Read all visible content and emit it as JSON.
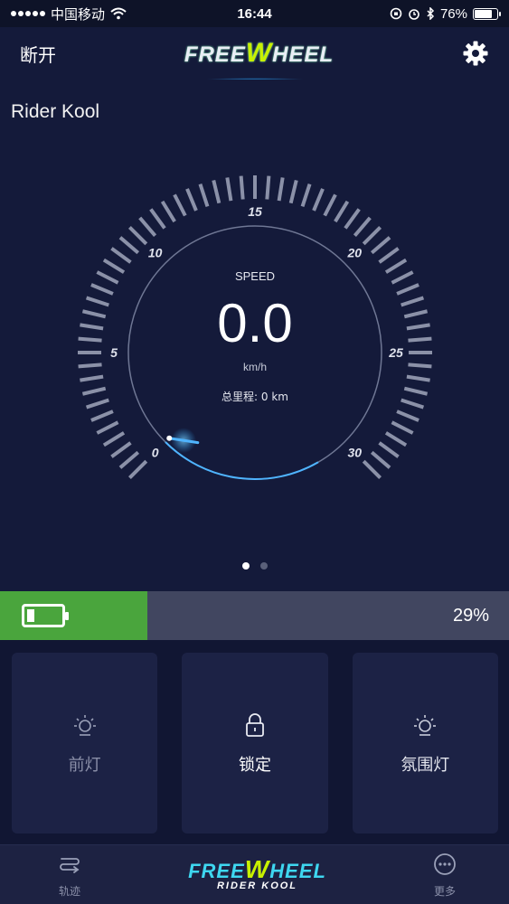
{
  "status_bar": {
    "carrier": "中国移动",
    "time": "16:44",
    "battery_pct": "76%"
  },
  "nav": {
    "left_label": "断开",
    "logo_pre": "FREE",
    "logo_w": "W",
    "logo_post": "HEEL",
    "settings_icon": "gear-icon"
  },
  "main": {
    "rider_name": "Rider Kool",
    "gauge": {
      "speed_label": "SPEED",
      "speed_value": "0.0",
      "unit": "km/h",
      "total_mileage": "总里程: 0 km",
      "tick_labels": [
        "0",
        "5",
        "10",
        "15",
        "20",
        "25",
        "30"
      ],
      "current_speed": 0
    },
    "page_dots": 2,
    "active_dot": 0
  },
  "battery": {
    "level": 0.29,
    "percent_text": "29%"
  },
  "controls": [
    {
      "label": "前灯",
      "icon": "sun-icon"
    },
    {
      "label": "锁定",
      "icon": "lock-icon"
    },
    {
      "label": "氛围灯",
      "icon": "sun-icon"
    }
  ],
  "tabbar": {
    "left_label": "轨迹",
    "logo_pre": "FREE",
    "logo_w": "W",
    "logo_post": "HEEL",
    "logo_sub": "RIDER KOOL",
    "right_label": "更多"
  },
  "colors": {
    "accent_blue": "#2aa8ff",
    "battery_green": "#4aa53d",
    "logo_green": "#c8f000"
  }
}
